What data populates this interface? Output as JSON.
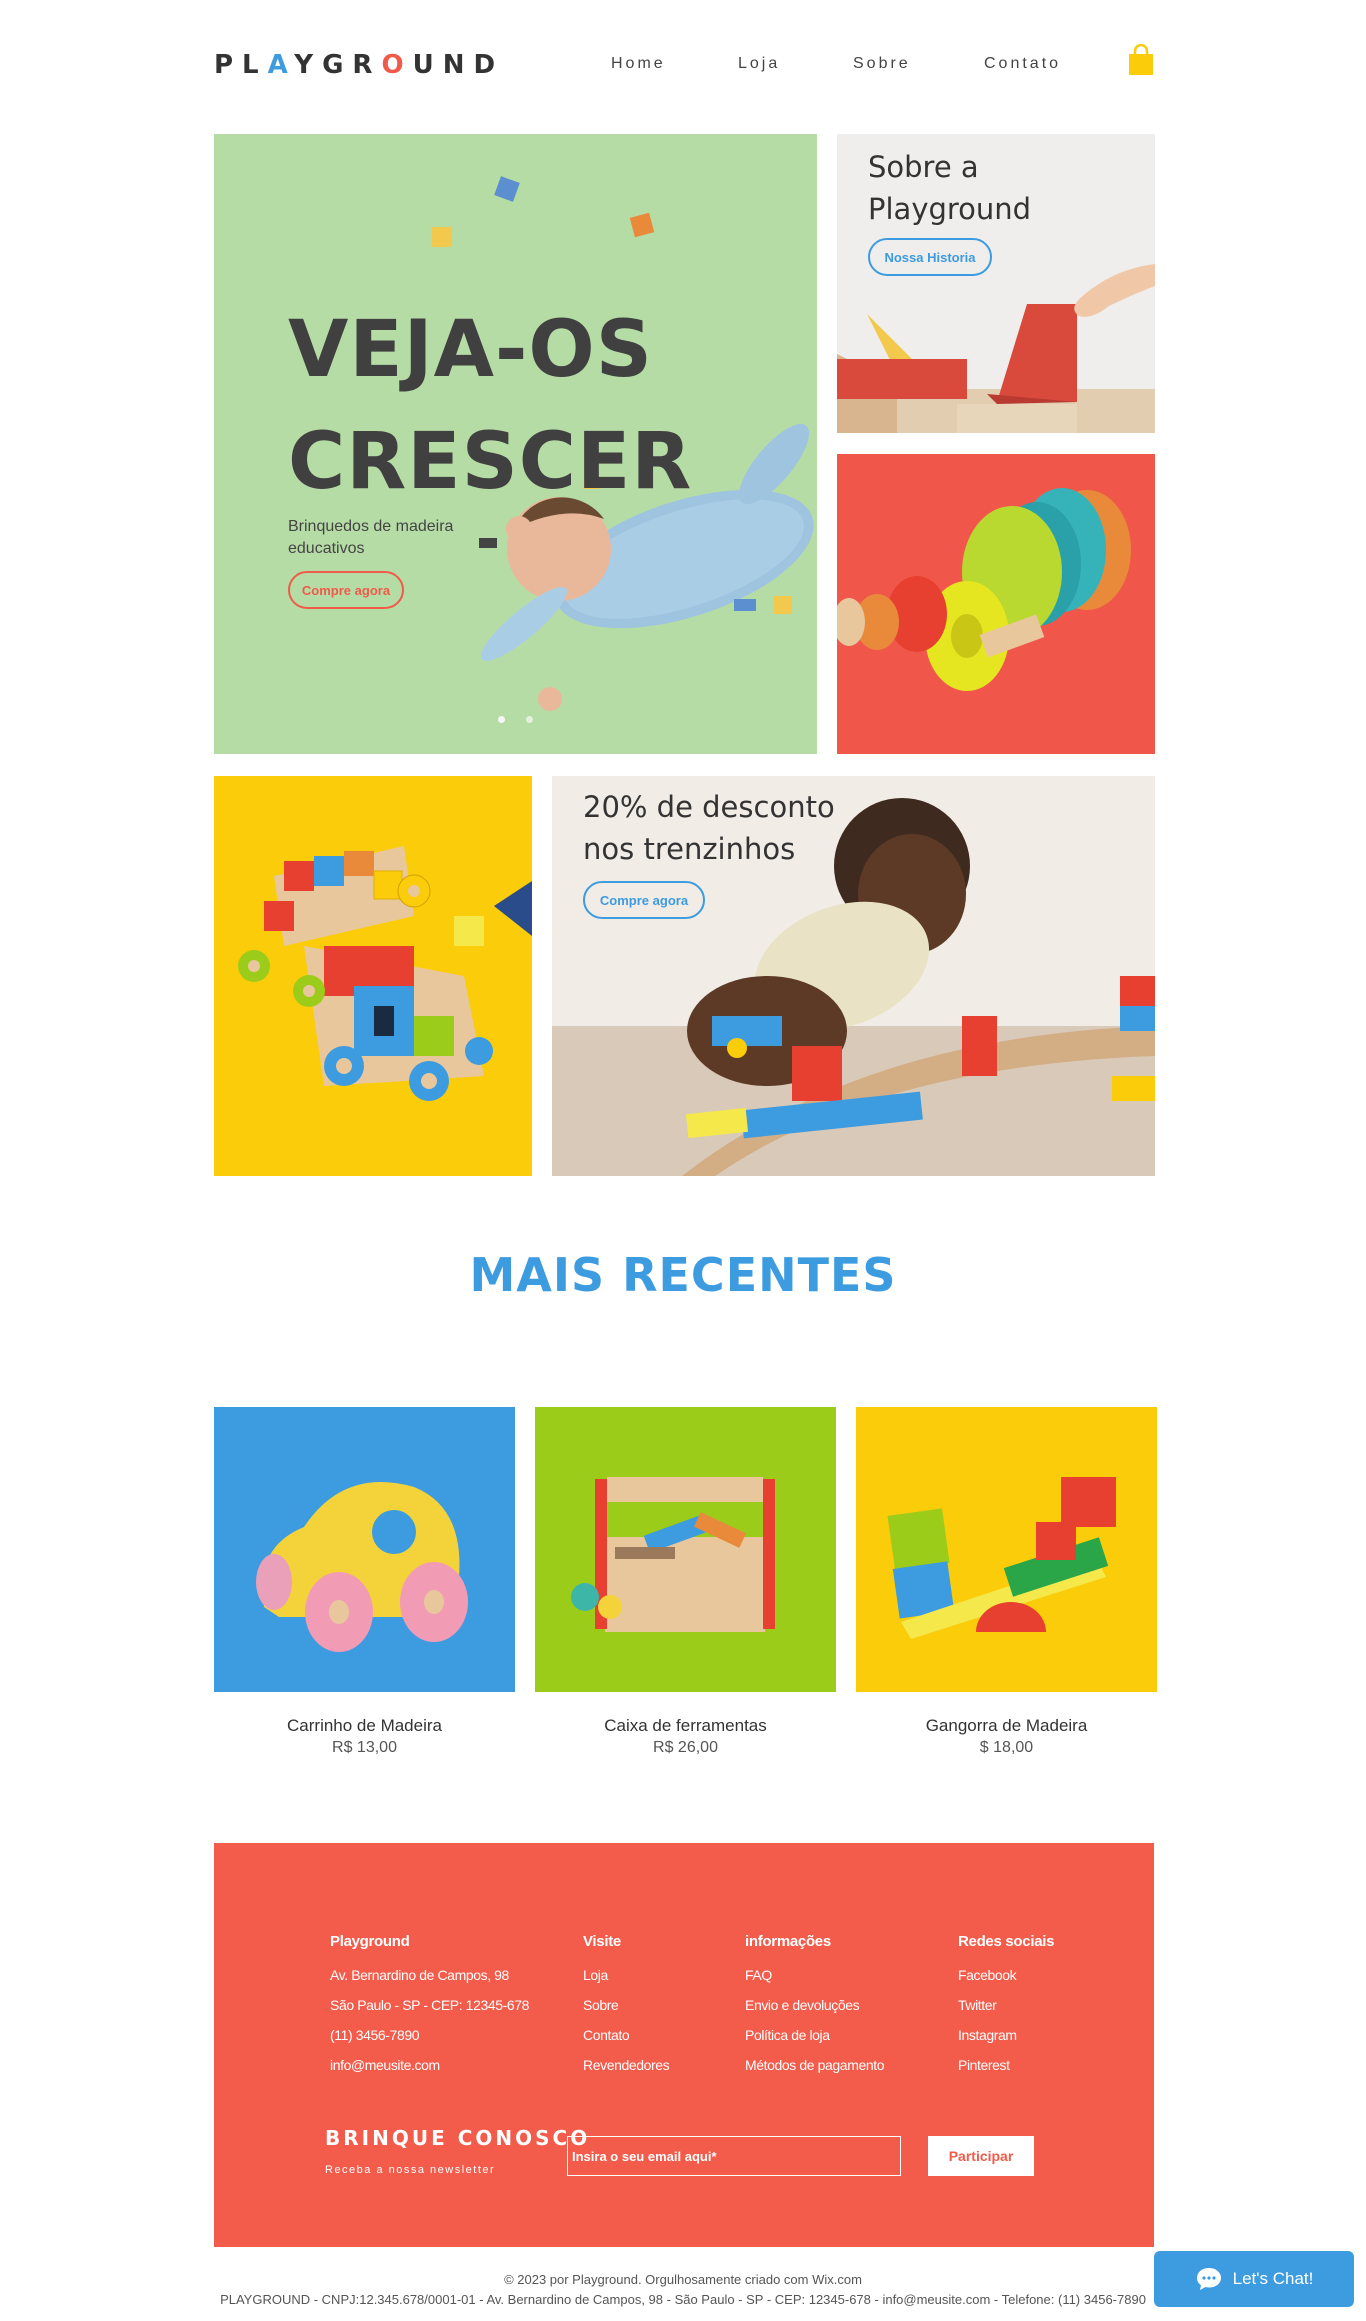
{
  "header": {
    "logo": {
      "p1": "PL",
      "a": "A",
      "p2": "YGR",
      "o": "O",
      "p3": "UND"
    },
    "nav": [
      "Home",
      "Loja",
      "Sobre",
      "Contato"
    ],
    "cart_icon": "shopping-bag-icon"
  },
  "hero": {
    "title_line1": "VEJA-OS",
    "title_line2": "CRESCER",
    "subtitle": "Brinquedos de madeira educativos",
    "cta": "Compre agora",
    "slides": 2
  },
  "about": {
    "title": "Sobre a Playground",
    "cta": "Nossa Historia"
  },
  "promo": {
    "title": "20% de desconto nos trenzinhos",
    "cta": "Compre agora"
  },
  "recent": {
    "title": "MAIS RECENTES",
    "products": [
      {
        "name": "Carrinho de Madeira",
        "price": "R$ 13,00",
        "bg": "#3d9be0"
      },
      {
        "name": "Caixa de ferramentas",
        "price": "R$ 26,00",
        "bg": "#9ccc1a"
      },
      {
        "name": "Gangorra de Madeira",
        "price": "$ 18,00",
        "bg": "#fbcc0a"
      }
    ]
  },
  "footer": {
    "col1": {
      "title": "Playground",
      "items": [
        "Av. Bernardino de Campos, 98",
        "São Paulo - SP - CEP: 12345-678",
        "(11) 3456-7890",
        "info@meusite.com"
      ]
    },
    "col2": {
      "title": "Visite",
      "items": [
        "Loja",
        "Sobre",
        "Contato",
        "Revendedores"
      ]
    },
    "col3": {
      "title": "informações",
      "items": [
        "FAQ",
        "Envio e devoluções",
        "Política de loja",
        "Métodos de pagamento"
      ]
    },
    "col4": {
      "title": "Redes sociais",
      "items": [
        "Facebook",
        "Twitter",
        "Instagram",
        "Pinterest"
      ]
    },
    "newsletter": {
      "title": "BRINQUE CONOSCO",
      "subtitle": "Receba a nossa newsletter",
      "placeholder": "Insira o seu email aqui*",
      "button": "Participar"
    },
    "copyright": "© 2023 por Playground. Orgulhosamente criado com Wix.com",
    "legal": "PLAYGROUND - CNPJ:12.345.678/0001-01 - Av. Bernardino de Campos, 98 - São Paulo - SP - CEP: 12345-678 - info@meusite.com - Telefone: (11) 3456-7890"
  },
  "chat": {
    "label": "Let's Chat!",
    "icon": "chat-bubble-icon"
  },
  "colors": {
    "blue": "#3d9be0",
    "red": "#f35b4a",
    "yellow": "#fbcc0a",
    "green_hero": "#b6dca6",
    "lime": "#9ccc1a"
  }
}
